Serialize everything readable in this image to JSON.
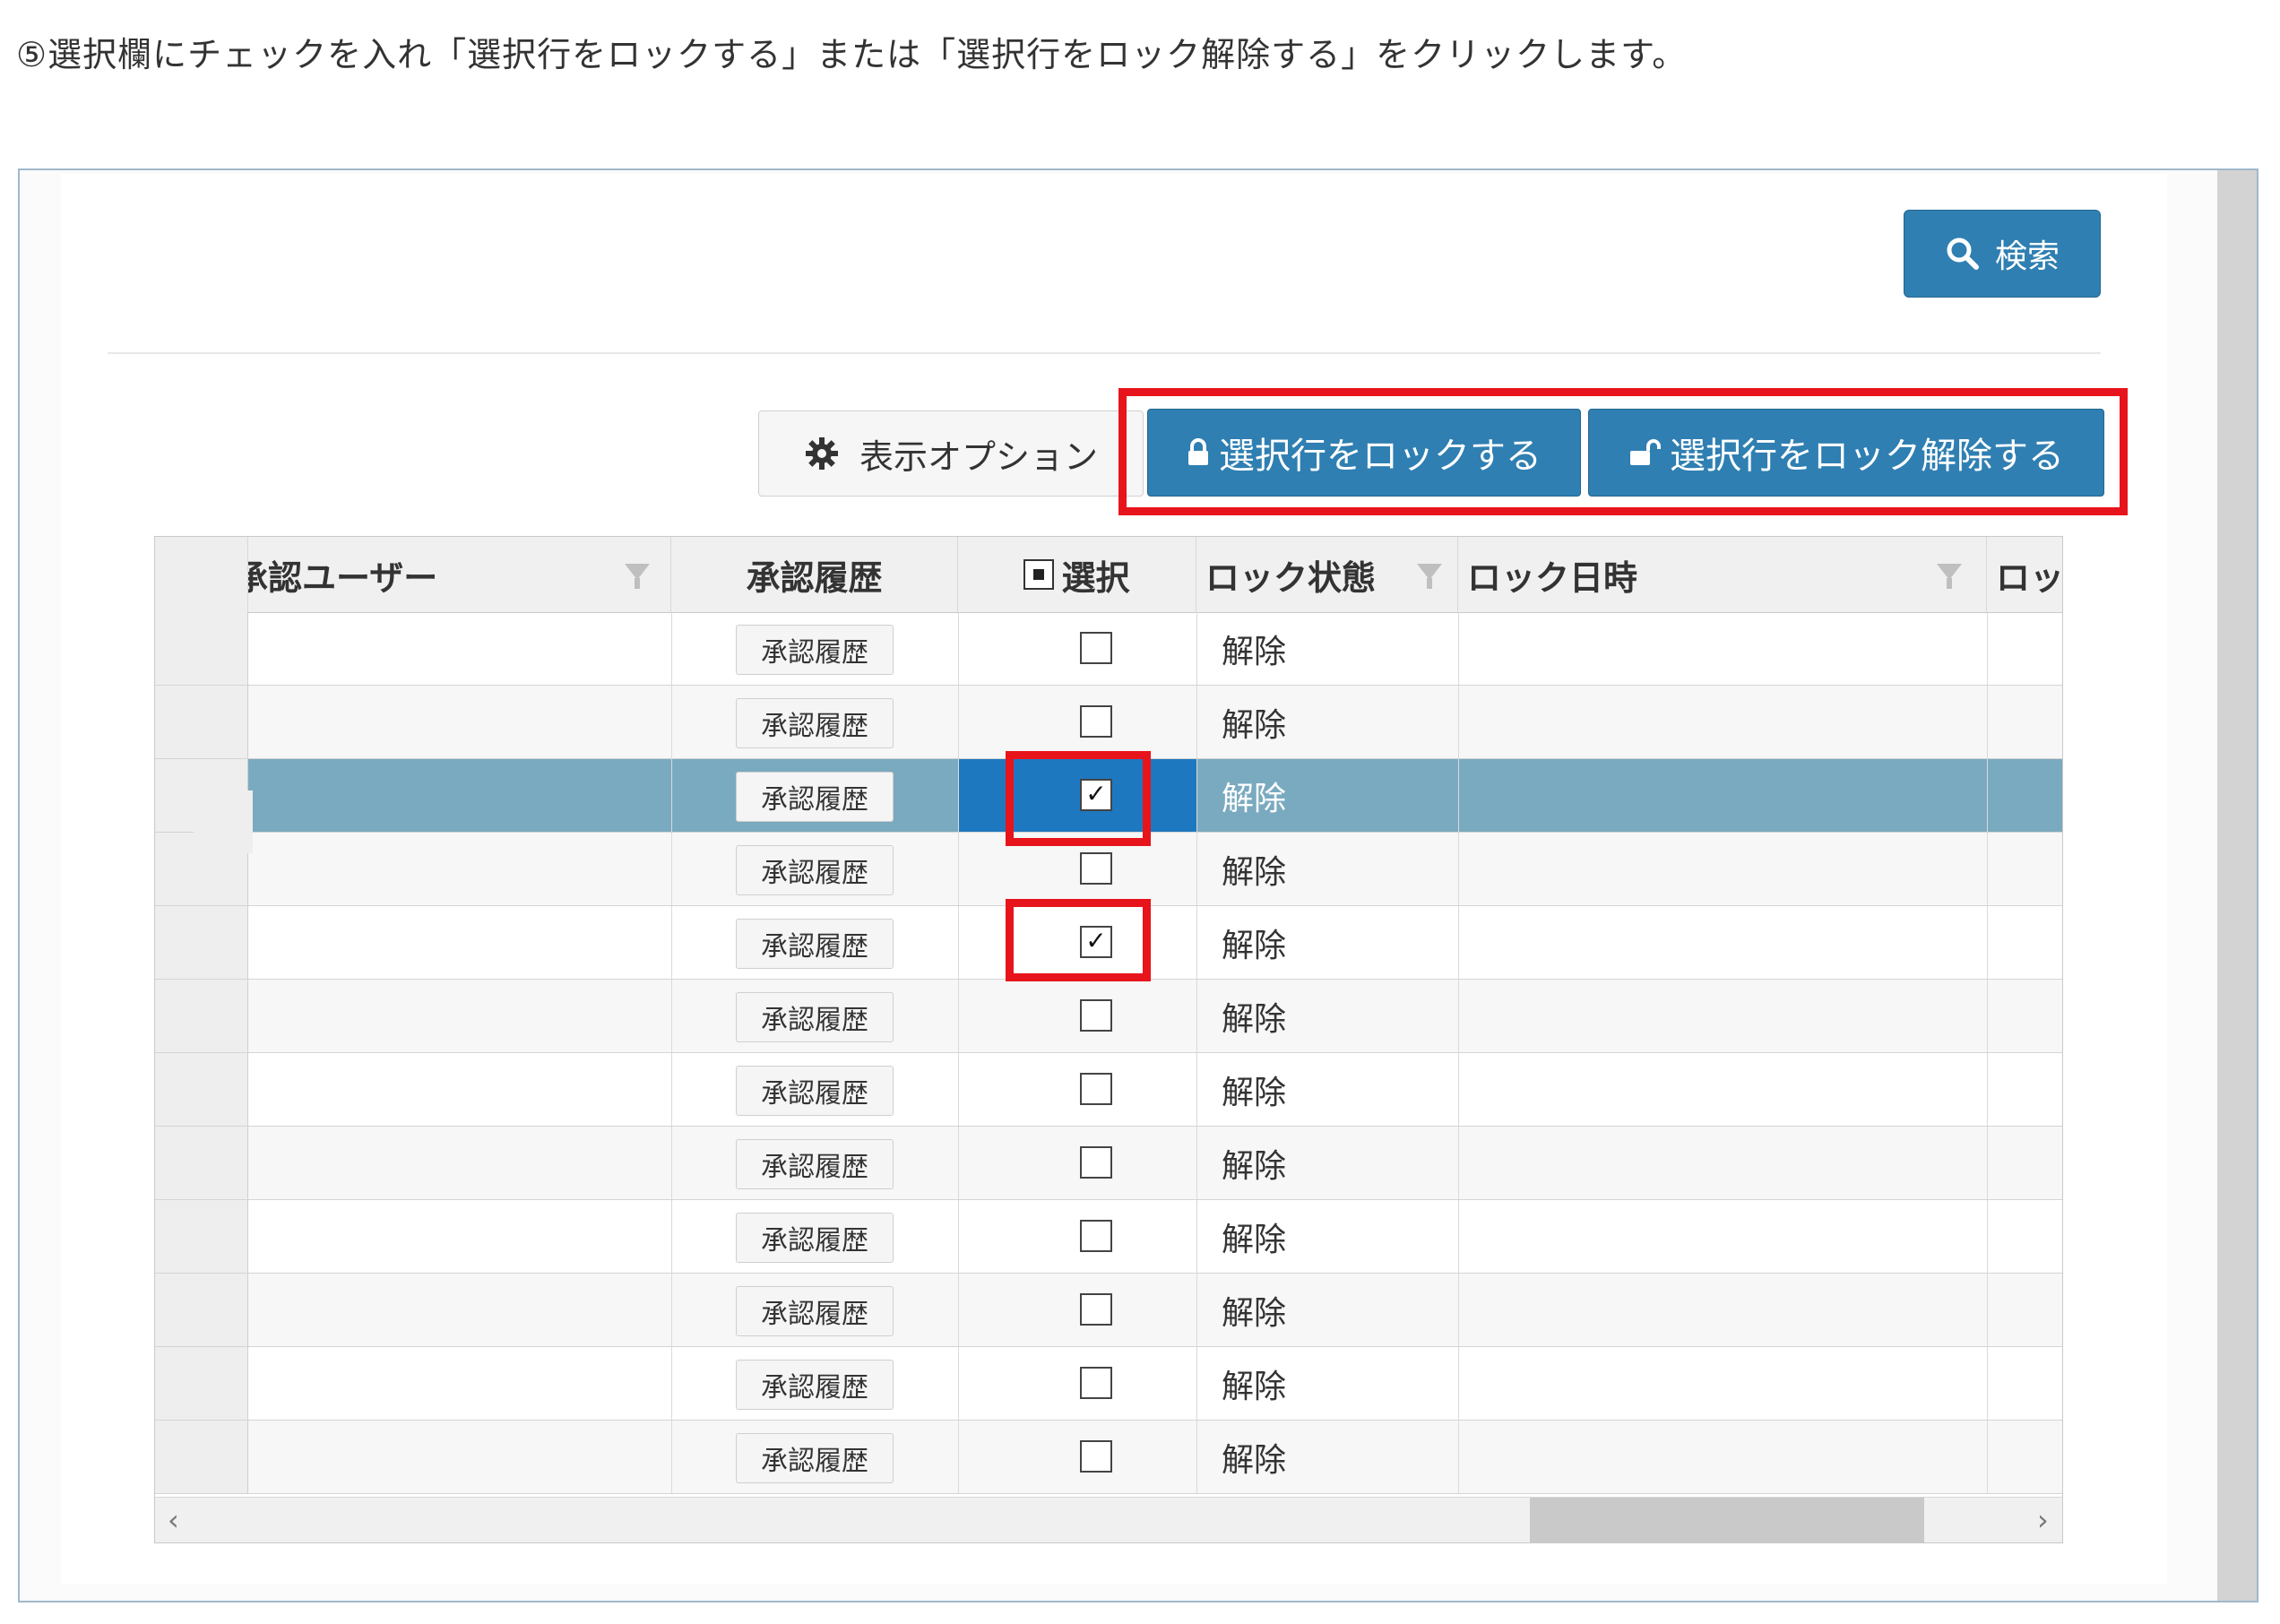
{
  "instruction": "⑤選択欄にチェックを入れ「選択行をロックする」または「選択行をロック解除する」をクリックします。",
  "toolbar": {
    "search_label": "検索",
    "options_label": "表示オプション",
    "lock_label": "選択行をロックする",
    "unlock_label": "選択行をロック解除する"
  },
  "grid": {
    "columns": [
      {
        "label": "承認ユーザー",
        "filter": true
      },
      {
        "label": "承認履歴",
        "filter": false
      },
      {
        "label": "選択",
        "filter": false
      },
      {
        "label": "ロック状態",
        "filter": true
      },
      {
        "label": "ロック日時",
        "filter": true
      },
      {
        "label": "ロッ",
        "filter": false
      }
    ],
    "history_button_label": "承認履歴",
    "rows": [
      {
        "checked": false,
        "state": "解除",
        "selected": false
      },
      {
        "checked": false,
        "state": "解除",
        "selected": false
      },
      {
        "checked": true,
        "state": "解除",
        "selected": true
      },
      {
        "checked": false,
        "state": "解除",
        "selected": false
      },
      {
        "checked": true,
        "state": "解除",
        "selected": false
      },
      {
        "checked": false,
        "state": "解除",
        "selected": false
      },
      {
        "checked": false,
        "state": "解除",
        "selected": false
      },
      {
        "checked": false,
        "state": "解除",
        "selected": false
      },
      {
        "checked": false,
        "state": "解除",
        "selected": false
      },
      {
        "checked": false,
        "state": "解除",
        "selected": false
      },
      {
        "checked": false,
        "state": "解除",
        "selected": false
      },
      {
        "checked": false,
        "state": "解除",
        "selected": false
      }
    ]
  },
  "colors": {
    "primary": "#2f7fb2",
    "highlight": "#e8141b",
    "selected_row": "#7aaabf",
    "selected_cell": "#1e78bf"
  }
}
